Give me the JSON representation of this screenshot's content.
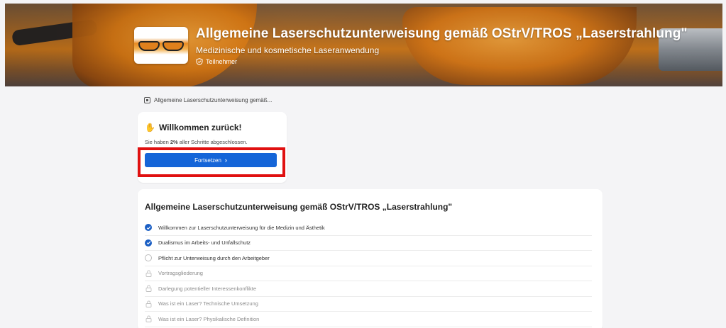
{
  "hero": {
    "title": "Allgemeine Laserschutzunterweisung gemäß OStrV/TROS „Laserstrahlung\"",
    "subtitle": "Medizinische und kosmetische Laseranwendung",
    "role": "Teilnehmer"
  },
  "breadcrumb": {
    "label": "Allgemeine Laserschutzunterweisung gemäß..."
  },
  "welcome": {
    "title": "Willkommen zurück!",
    "progress_prefix": "Sie haben ",
    "progress_value": "2%",
    "progress_suffix": " aller Schritte abgeschlossen.",
    "continue_label": "Fortsetzen"
  },
  "course": {
    "title": "Allgemeine Laserschutzunterweisung gemäß OStrV/TROS „Laserstrahlung\"",
    "steps": [
      {
        "label": "Willkommen zur Laserschutzunterweisung für die Medizin und Ästhetik",
        "status": "done"
      },
      {
        "label": "Dualismus im Arbeits- und Unfallschutz",
        "status": "done"
      },
      {
        "label": "Pflicht zur Unterweisung durch den Arbeitgeber",
        "status": "open"
      },
      {
        "label": "Vortragsgliederung",
        "status": "locked"
      },
      {
        "label": "Darlegung potentieller Interessenkonflikte",
        "status": "locked"
      },
      {
        "label": "Was ist ein Laser? Technische Umsetzung",
        "status": "locked"
      },
      {
        "label": "Was ist ein Laser? Physikalische Definition",
        "status": "locked"
      }
    ]
  },
  "colors": {
    "accent": "#1565d8",
    "highlight_border": "#e01010",
    "done_check": "#1b5fc4"
  },
  "icons": {
    "role": "shield-check-icon",
    "breadcrumb": "course-icon",
    "welcome": "waving-hand-icon",
    "continue": "chevron-right-icon",
    "done": "check-circle-icon",
    "open": "empty-circle-icon",
    "locked": "lock-icon"
  }
}
